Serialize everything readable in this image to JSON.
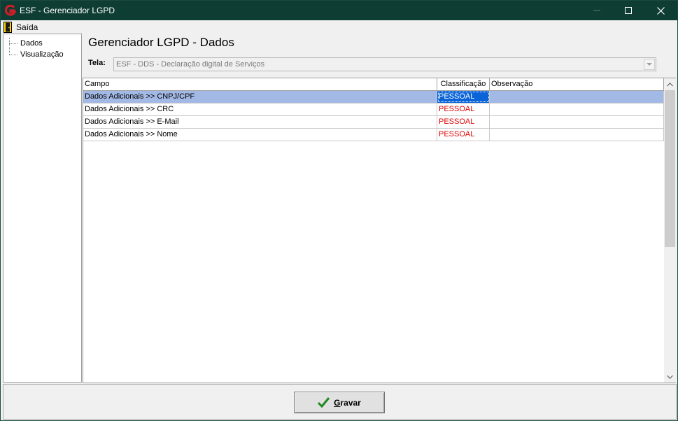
{
  "window": {
    "title": "ESF - Gerenciador LGPD",
    "brand_color": "#cc1f2a",
    "titlebar_color": "#0e3d34"
  },
  "menu": {
    "exit_label": "Saída"
  },
  "tree": {
    "items": [
      {
        "label": "Dados"
      },
      {
        "label": "Visualização"
      }
    ]
  },
  "main": {
    "title": "Gerenciador LGPD - Dados",
    "tela_label": "Tela:",
    "tela_value": "ESF - DDS - Declaração digital de Serviços"
  },
  "grid": {
    "columns": [
      "Campo",
      "Classificação",
      "Observação"
    ],
    "rows": [
      {
        "campo": "Dados Adicionais >> CNPJ/CPF",
        "classificacao": "PESSOAL",
        "observacao": "",
        "selected": true
      },
      {
        "campo": "Dados Adicionais >> CRC",
        "classificacao": "PESSOAL",
        "observacao": ""
      },
      {
        "campo": "Dados Adicionais >> E-Mail",
        "classificacao": "PESSOAL",
        "observacao": ""
      },
      {
        "campo": "Dados Adicionais >> Nome",
        "classificacao": "PESSOAL",
        "observacao": ""
      }
    ]
  },
  "footer": {
    "save_first": "G",
    "save_rest": "ravar"
  }
}
